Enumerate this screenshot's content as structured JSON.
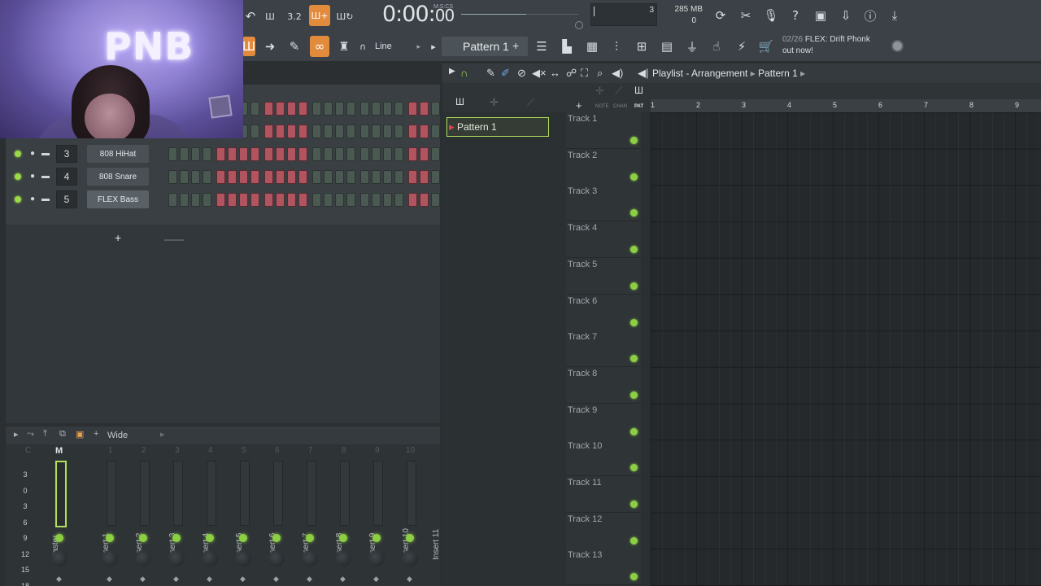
{
  "toolbar": {
    "time": "0:00",
    "time_cs": "00",
    "time_format_label": "M:S:CS",
    "cpu_value": "3",
    "memory": "285 MB",
    "polyphony": "0",
    "snap_mode": "Line",
    "pattern_name": "Pattern 1",
    "hint_counter": "02/26",
    "hint_text": "FLEX: Drift Phonk",
    "hint_text2": "out now!"
  },
  "webcam": {
    "neon_sign": "PNB"
  },
  "channel_rack": {
    "channels": [
      {
        "number": "3",
        "name": "808 HiHat"
      },
      {
        "number": "4",
        "name": "808 Snare"
      },
      {
        "number": "5",
        "name": "FLEX Bass"
      }
    ],
    "add_label": "+"
  },
  "mixer": {
    "preset": "Wide",
    "master_label": "M",
    "db_scale": [
      "3",
      "0",
      "3",
      "6",
      "9",
      "12",
      "15",
      "18"
    ],
    "strips": [
      "Master",
      "Insert 1",
      "Insert 2",
      "Insert 3",
      "Insert 4",
      "Insert 5",
      "Insert 6",
      "Insert 7",
      "Insert 8",
      "Insert 9",
      "Insert 10",
      "Insert 11"
    ]
  },
  "playlist": {
    "title": "Playlist - Arrangement",
    "title_pattern": "Pattern 1",
    "picker_pattern": "Pattern 1",
    "header_labels": [
      "NOTE",
      "CHAN",
      "PAT"
    ],
    "ruler": [
      "1",
      "2",
      "3",
      "4",
      "5",
      "6",
      "7",
      "8",
      "9"
    ],
    "tracks": [
      "Track 1",
      "Track 2",
      "Track 3",
      "Track 4",
      "Track 5",
      "Track 6",
      "Track 7",
      "Track 8",
      "Track 9",
      "Track 10",
      "Track 11",
      "Track 12",
      "Track 13"
    ]
  },
  "colors": {
    "accent_orange": "#e38b3d",
    "accent_green": "#b3e05a",
    "led_green": "#8ccf43",
    "step_red": "#b05560"
  }
}
